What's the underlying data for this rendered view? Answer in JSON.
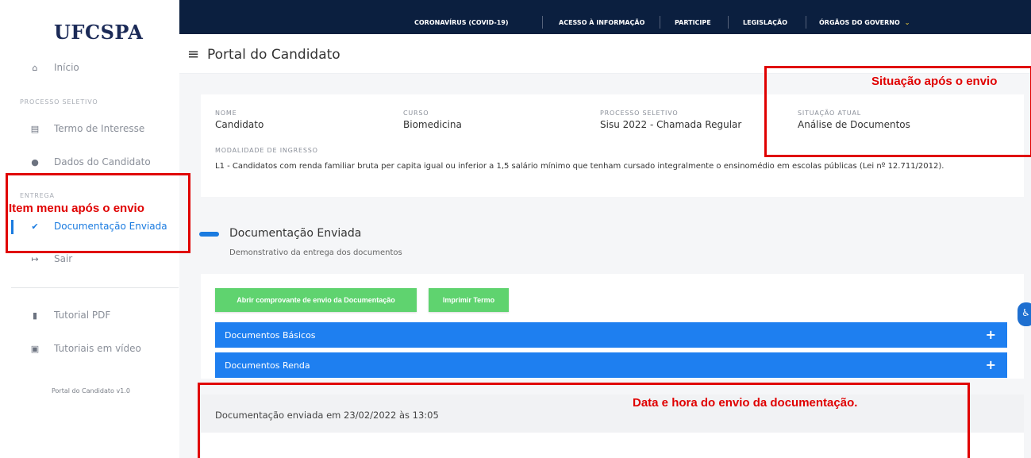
{
  "sidebar": {
    "logo": "UFCSPA",
    "inicio": "Início",
    "section_processo": "PROCESSO SELETIVO",
    "termo": "Termo de Interesse",
    "dados": "Dados do Candidato",
    "section_entrega": "ENTREGA",
    "documentacao": "Documentação Enviada",
    "sair": "Sair",
    "tutorial_pdf": "Tutorial PDF",
    "tutoriais_video": "Tutoriais em vídeo",
    "version": "Portal do Candidato v1.0"
  },
  "topnav": {
    "covid": "CORONAVÍRUS (COVID-19)",
    "acesso": "ACESSO À INFORMAÇÃO",
    "participe": "PARTICIPE",
    "legislacao": "LEGISLAÇÃO",
    "orgaos": "ÓRGÃOS DO GOVERNO"
  },
  "header": {
    "title": "Portal do Candidato"
  },
  "info": {
    "nome_label": "NOME",
    "nome": "Candidato",
    "curso_label": "CURSO",
    "curso": "Biomedicina",
    "processo_label": "PROCESSO SELETIVO",
    "processo": "Sisu 2022 - Chamada Regular",
    "situacao_label": "SITUAÇÃO ATUAL",
    "situacao": "Análise de Documentos",
    "modalidade_label": "MODALIDADE DE INGRESSO",
    "modalidade": "L1 - Candidatos com renda familiar bruta per capita igual ou inferior a 1,5 salário mínimo que tenham cursado integralmente o ensinomédio em escolas públicas (Lei nº 12.711/2012)."
  },
  "section": {
    "title": "Documentação Enviada",
    "subtitle": "Demonstrativo da entrega dos documentos"
  },
  "buttons": {
    "comprovante": "Abrir comprovante de envio da Documentação",
    "imprimir": "Imprimir Termo"
  },
  "accordions": [
    {
      "label": "Documentos Básicos",
      "icon": "+"
    },
    {
      "label": "Documentos Renda",
      "icon": "+"
    }
  ],
  "sent": {
    "text": "Documentação enviada em 23/02/2022 às 13:05"
  },
  "annotations": {
    "situacao": "Situação após o envio",
    "menu": "Item menu após o envio",
    "data": "Data e hora do envio da documentação."
  },
  "colors": {
    "accent": "#1a7be0",
    "nav": "#0b1f3f",
    "green": "#5fd36f",
    "annotation": "#e00000"
  }
}
